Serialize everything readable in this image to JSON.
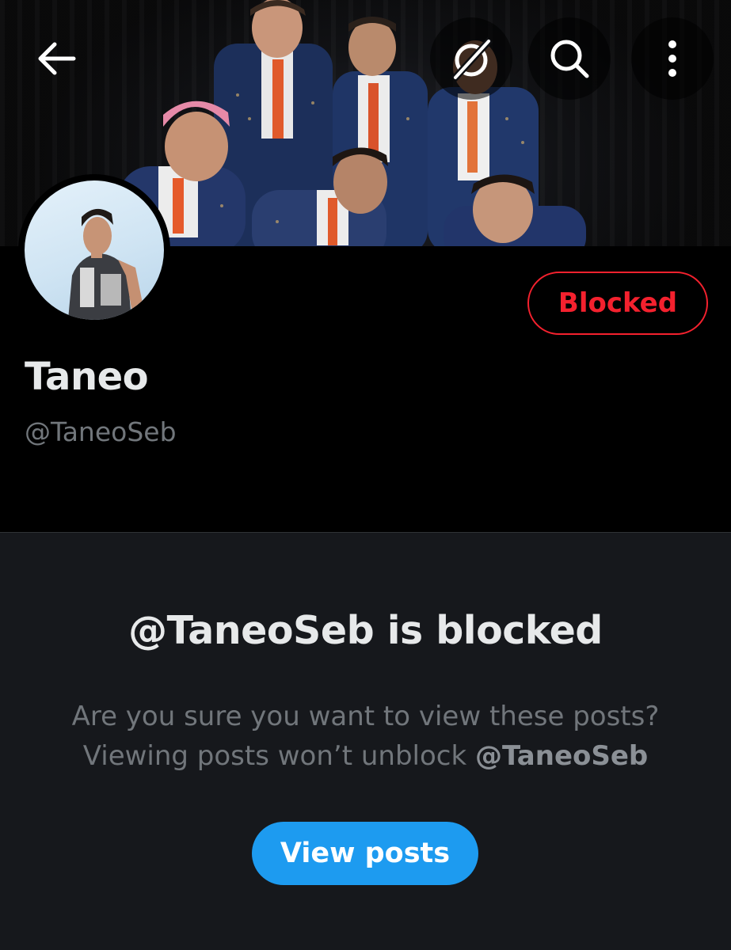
{
  "header": {
    "back_icon": "arrow-left-icon",
    "grok_icon": "grok-slash-icon",
    "search_icon": "search-icon",
    "more_icon": "more-vertical-icon"
  },
  "profile": {
    "display_name": "Taneo",
    "handle": "@TaneoSeb",
    "blocked_button_label": "Blocked"
  },
  "blocked_notice": {
    "title": "@TaneoSeb is blocked",
    "message_line1": "Are you sure you want to view these posts?",
    "message_line2_prefix": "Viewing posts won’t unblock ",
    "message_line2_handle": "@TaneoSeb",
    "view_posts_label": "View posts"
  },
  "colors": {
    "accent": "#1d9bf0",
    "blocked_red": "#f4212e",
    "background": "#000000",
    "panel_background": "#16181c"
  }
}
